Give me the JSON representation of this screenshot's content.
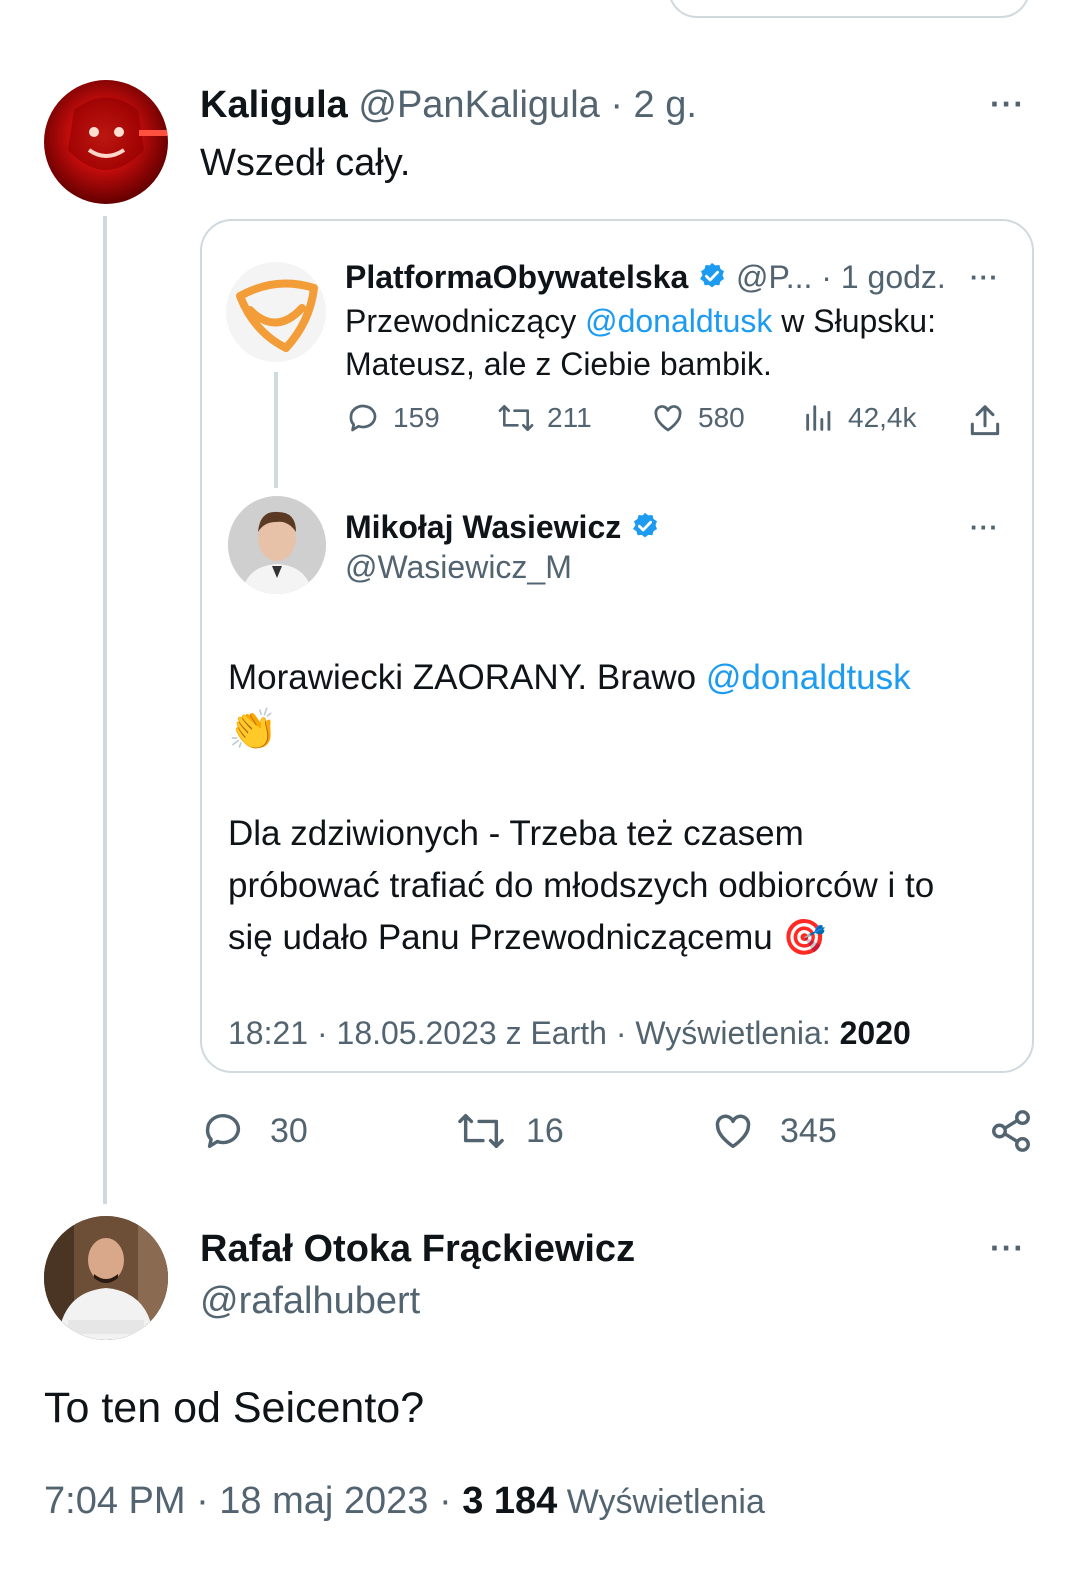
{
  "main_tweet": {
    "author_name": "Kaligula",
    "meta": "@PanKaligula · 2 g.",
    "text": "Wszedł cały."
  },
  "quote": {
    "original": {
      "name": "PlatformaObywatelska",
      "meta": "@P... · 1 godz.",
      "text_line1_pre": "Przewodniczący ",
      "text_line1_mention": "@donaldtusk",
      "text_line1_post": " w Słupsku:",
      "text_line2": "Mateusz, ale z Ciebie bambik.",
      "stats": {
        "replies": "159",
        "retweets": "211",
        "likes": "580",
        "views": "42,4k"
      }
    },
    "reply": {
      "name": "Mikołaj Wasiewicz",
      "handle": "@Wasiewicz_M",
      "line1_pre": "Morawiecki ZAORANY. Brawo ",
      "line1_mention": "@donaldtusk",
      "emoji1": "👏",
      "para2_line1": "Dla zdziwionych - Trzeba też czasem",
      "para2_line2": "próbować trafiać do młodszych odbiorców i to",
      "para2_line3": "się udało Panu Przewodniczącemu",
      "emoji2": "🎯",
      "footer_meta": "18:21 · 18.05.2023 z Earth · Wyświetlenia: ",
      "footer_views": "2020"
    }
  },
  "actions": {
    "replies": "30",
    "retweets": "16",
    "likes": "345"
  },
  "reply_tweet": {
    "author_name": "Rafał Otoka Frąckiewicz",
    "handle": "@rafalhubert",
    "text": "To ten od Seicento?",
    "time": "7:04 PM · 18 maj 2023 · ",
    "views_count": "3 184",
    "views_label": " Wyświetlenia"
  },
  "more_label": "···",
  "colors": {
    "link": "#1d9bf0",
    "muted": "#536471",
    "verified": "#1d9bf0",
    "brand_orange": "#f29d38"
  }
}
